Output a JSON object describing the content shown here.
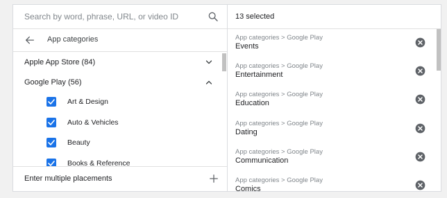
{
  "search": {
    "placeholder": "Search by word, phrase, URL, or video ID"
  },
  "nav": {
    "back_label": "App categories"
  },
  "tree": {
    "groups": [
      {
        "label": "Apple App Store (84)",
        "expanded": false
      },
      {
        "label": "Google Play (56)",
        "expanded": true
      }
    ],
    "children": [
      {
        "label": "Art & Design",
        "checked": true
      },
      {
        "label": "Auto & Vehicles",
        "checked": true
      },
      {
        "label": "Beauty",
        "checked": true
      },
      {
        "label": "Books & Reference",
        "checked": true
      }
    ]
  },
  "footer": {
    "enter_label": "Enter multiple placements"
  },
  "selected": {
    "count_label": "13 selected",
    "items": [
      {
        "path": "App categories > Google Play",
        "name": "Events"
      },
      {
        "path": "App categories > Google Play",
        "name": "Entertainment"
      },
      {
        "path": "App categories > Google Play",
        "name": "Education"
      },
      {
        "path": "App categories > Google Play",
        "name": "Dating"
      },
      {
        "path": "App categories > Google Play",
        "name": "Communication"
      },
      {
        "path": "App categories > Google Play",
        "name": "Comics"
      }
    ]
  },
  "colors": {
    "accent": "#1a73e8",
    "muted": "#80868b",
    "border": "#dadce0"
  },
  "icons": [
    "search-icon",
    "back-arrow-icon",
    "chevron-down-icon",
    "chevron-up-icon",
    "check-icon",
    "plus-icon",
    "remove-circle-icon"
  ]
}
